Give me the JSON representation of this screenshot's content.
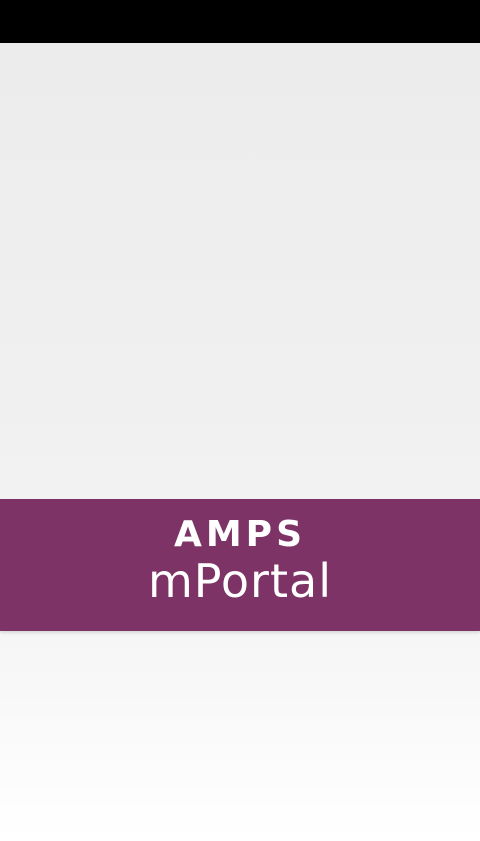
{
  "app": {
    "logo_line1": "AMPS",
    "logo_line2": "mPortal"
  },
  "colors": {
    "status_bar": "#000000",
    "brand_band": "#7d3366",
    "logo_text": "#ffffff",
    "background": "#efefef"
  }
}
